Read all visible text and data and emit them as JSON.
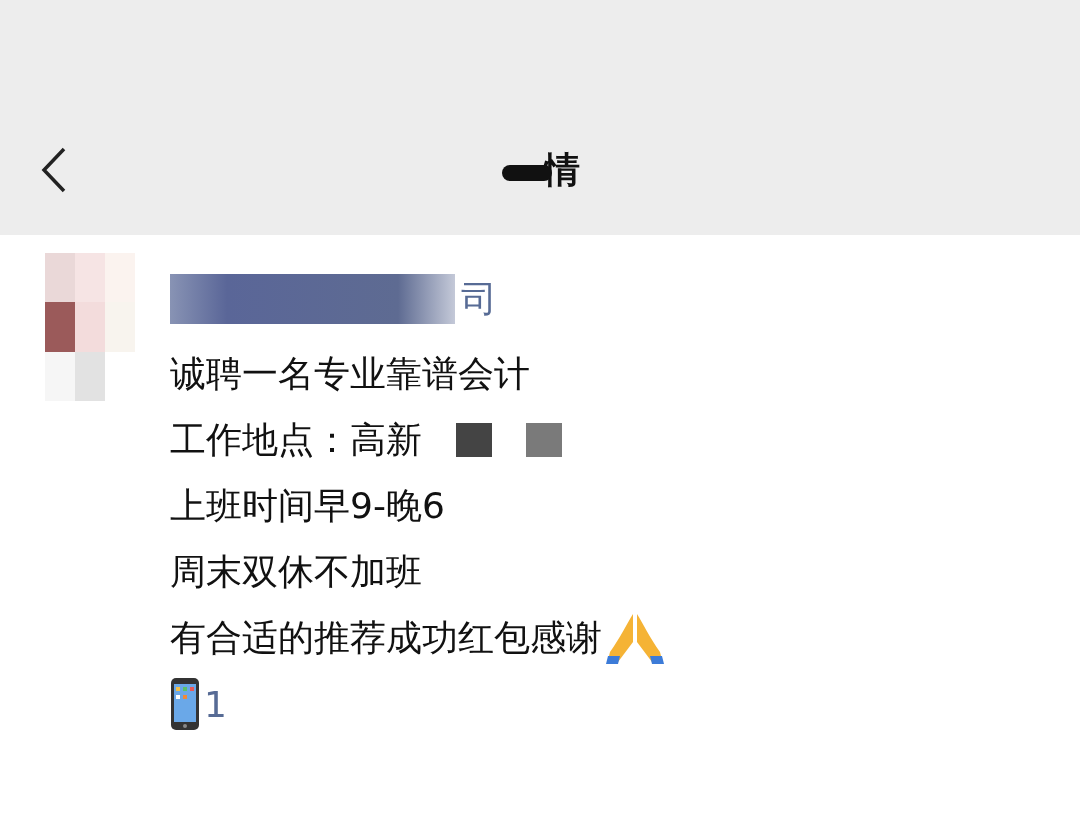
{
  "header": {
    "title": "情"
  },
  "post": {
    "author": "司",
    "lines": [
      {
        "text": "诚聘一名专业靠谱会计",
        "kind": "plain"
      },
      {
        "text": "工作地点：高新",
        "kind": "redacted"
      },
      {
        "text": "上班时间早9-晚6",
        "kind": "plain"
      },
      {
        "text": "周末双休不加班",
        "kind": "plain"
      },
      {
        "text": "有合适的推荐成功红包感谢",
        "kind": "pray"
      },
      {
        "text": "1",
        "kind": "phone"
      }
    ]
  }
}
